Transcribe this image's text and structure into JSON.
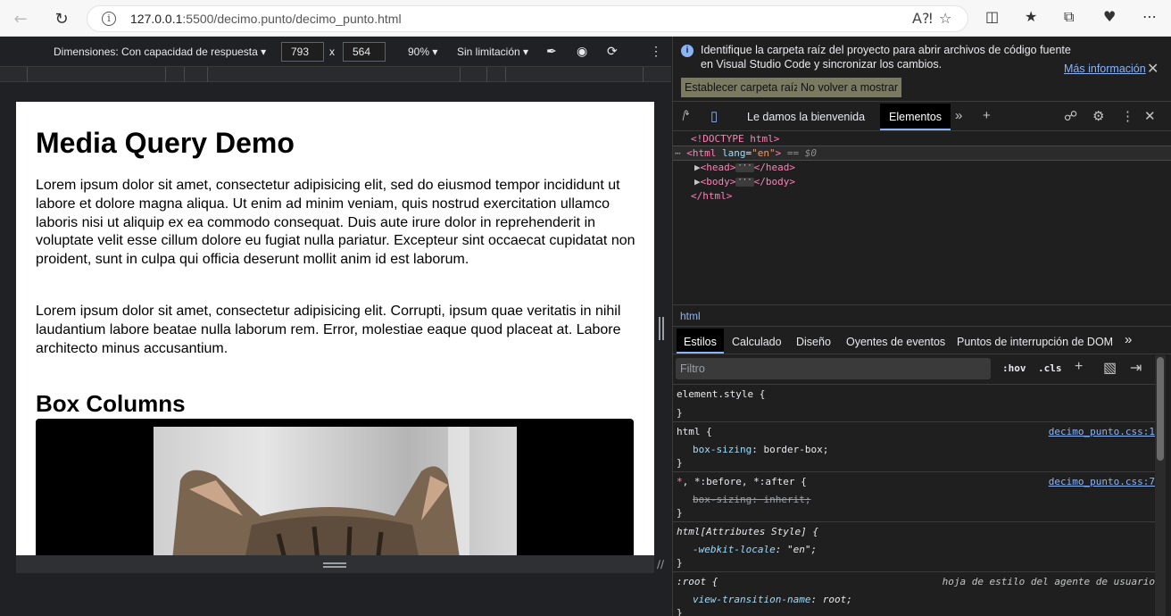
{
  "browser": {
    "url_host": "127.0.0.1",
    "url_path": ":5500/decimo.punto/decimo_punto.html"
  },
  "device_toolbar": {
    "dimensions_label": "Dimensiones: Con capacidad de respuesta",
    "width": "793",
    "height": "564",
    "times": "x",
    "zoom": "90%",
    "throttle": "Sin limitación"
  },
  "page": {
    "title": "Media Query Demo",
    "paragraph1": "Lorem ipsum dolor sit amet, consectetur adipisicing elit, sed do eiusmod tempor incididunt ut labore et dolore magna aliqua. Ut enim ad minim veniam, quis nostrud exercitation ullamco laboris nisi ut aliquip ex ea commodo consequat. Duis aute irure dolor in reprehenderit in voluptate velit esse cillum dolore eu fugiat nulla pariatur. Excepteur sint occaecat cupidatat non proident, sunt in culpa qui officia deserunt mollit anim id est laborum.",
    "paragraph2": "Lorem ipsum dolor sit amet, consectetur adipisicing elit. Corrupti, ipsum quae veritatis in nihil laudantium labore beatae nulla laborum rem. Error, molestiae eaque quod placeat at. Labore architecto minus accusantium.",
    "section_title": "Box Columns"
  },
  "devtools": {
    "info_message": "Identifique la carpeta raíz del proyecto para abrir archivos de código fuente en Visual Studio Code y sincronizar los cambios.",
    "info_more": "Más información",
    "btn_set_root": "Establecer carpeta raíz",
    "btn_dont_show": "No volver a mostrar",
    "tabs": {
      "welcome": "Le damos la bienvenida",
      "elements": "Elementos"
    },
    "dom": {
      "doctype": "<!DOCTYPE html>",
      "html_open": "<html",
      "lang_attr": "lang",
      "lang_val": "\"en\"",
      "html_close_bracket": ">",
      "eq_sign": "== $0",
      "head_open": "<head>",
      "head_close": "</head>",
      "body_open": "<body>",
      "body_close": "</body>",
      "html_close": "</html>",
      "ellipsis": "···"
    },
    "breadcrumb": "html",
    "subtabs": [
      "Estilos",
      "Calculado",
      "Diseño",
      "Oyentes de eventos",
      "Puntos de interrupción de DOM"
    ],
    "filter_placeholder": "Filtro",
    "hov": ":hov",
    "cls": ".cls",
    "rules": {
      "r1_selector": "element.style {",
      "close": "}",
      "r2_selector": "html {",
      "r2_source": "decimo_punto.css:1",
      "r2_prop": "box-sizing",
      "r2_val": "border-box;",
      "r3_star": "*",
      "r3_selector_rest": ", *:before, *:after {",
      "r3_source": "decimo_punto.css:7",
      "r3_prop": "box-sizing",
      "r3_val": "inherit;",
      "r4_selector": "html[Attributes Style] {",
      "r4_prop": "-webkit-locale",
      "r4_val": "\"en\";",
      "r5_selector": ":root {",
      "r5_source": "hoja de estilo del agente de usuario",
      "r5_prop": "view-transition-name",
      "r5_val": "root;",
      "colon": ": "
    }
  }
}
